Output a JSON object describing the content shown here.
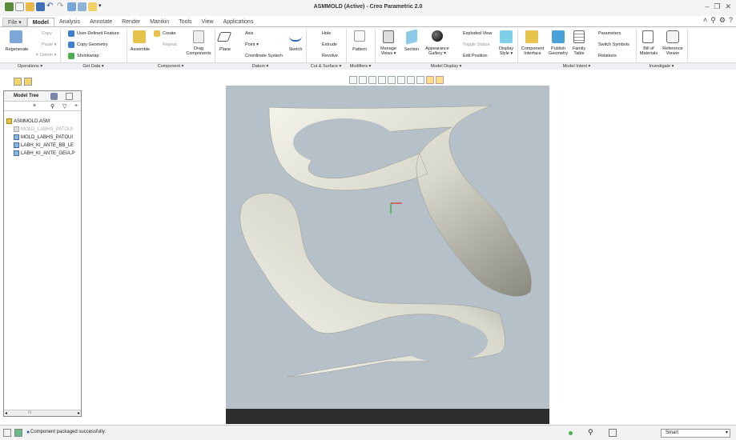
{
  "window": {
    "title": "ASMMOLD (Active) - Creo Parametric 2.0"
  },
  "tabs": [
    "File ▾",
    "Model",
    "Analysis",
    "Annotate",
    "Render",
    "Manikin",
    "Tools",
    "View",
    "Applications"
  ],
  "ribbon": {
    "operations": {
      "regenerate": "Regenerate",
      "copy": "Copy",
      "paste": "Paste ▾",
      "delete": "✕ Delete ▾",
      "label": "Operations ▾"
    },
    "get_data": {
      "udf": "User-Defined Feature",
      "copy_geom": "Copy Geometry",
      "shrinkwrap": "Shrinkwrap",
      "label": "Get Data ▾"
    },
    "component": {
      "assemble": "Assemble",
      "create": "Create",
      "repeat": "Repeat",
      "drag1": "Drag",
      "drag2": "Components",
      "label": "Component ▾"
    },
    "datum": {
      "plane": "Plane",
      "axis": "Axis",
      "point": "Point ▾",
      "csys": "Coordinate System",
      "sketch": "Sketch",
      "label": "Datum ▾"
    },
    "cut_surface": {
      "hole": "Hole",
      "extrude": "Extrude",
      "revolve": "Revolve",
      "label": "Cut & Surface ▾"
    },
    "modifiers": {
      "pattern": "Pattern",
      "label": "Modifiers ▾"
    },
    "model_display": {
      "manage1": "Manage",
      "manage2": "Views ▾",
      "section": "Section",
      "appearance1": "Appearance",
      "appearance2": "Gallery ▾",
      "exploded": "Exploded View",
      "toggle_status": "Toggle Status",
      "edit_position": "Edit Position",
      "display1": "Display",
      "display2": "Style ▾",
      "label": "Model Display ▾"
    },
    "model_intent": {
      "ci1": "Component",
      "ci2": "Interface",
      "pg1": "Publish",
      "pg2": "Geometry",
      "ft1": "Family",
      "ft2": "Table",
      "parameters": "Parameters",
      "switch_symbols": "Switch Symbols",
      "relations": "Relations",
      "label": "Model Intent ▾"
    },
    "investigate": {
      "bom1": "Bill of",
      "bom2": "Materials",
      "rv1": "Reference",
      "rv2": "Viewer",
      "label": "Investigate ▾"
    }
  },
  "model_tree": {
    "title": "Model Tree",
    "search_clear": "×",
    "items": [
      {
        "label": "ASMMOLD.ASM",
        "dim": false
      },
      {
        "label": "MOLD_LABHS_PATOUI",
        "dim": true
      },
      {
        "label": "MOLD_LABHS_PATOUI",
        "dim": false
      },
      {
        "label": "LABH_KI_ANTE_BB_LE",
        "dim": false
      },
      {
        "label": "LABH_KI_ANTE_GEIA.P",
        "dim": false
      }
    ],
    "scroll_value": "III"
  },
  "status": {
    "message": "Component packaged successfully.",
    "selection_filter": "Smart"
  },
  "colors": {
    "viewport_bg": "#b5c0c9",
    "part": "#e8e7dc",
    "block_bottom": "#2e2e2e"
  }
}
